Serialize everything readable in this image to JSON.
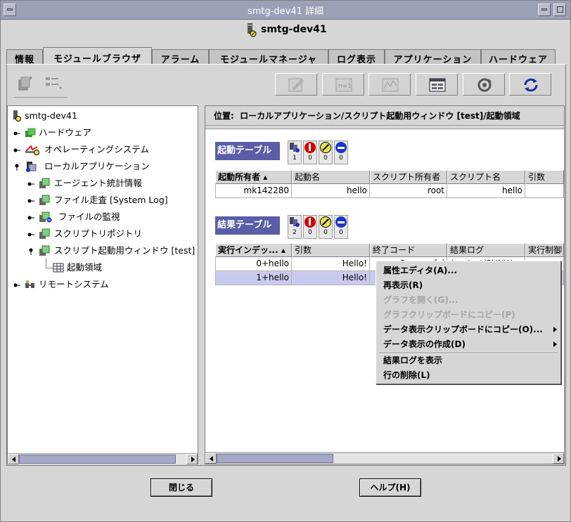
{
  "window": {
    "title": "smtg-dev41 詳細",
    "host": "smtg-dev41"
  },
  "tabs": [
    "情報",
    "モジュールブラウザ",
    "アラーム",
    "モジュールマネージャ",
    "ログ表示",
    "アプリケーション",
    "ハードウェア"
  ],
  "active_tab": "モジュールブラウザ",
  "tree": {
    "root": "smtg-dev41",
    "items": [
      "ハードウェア",
      "オペレーティングシステム",
      "ローカルアプリケーション",
      "エージェント統計情報",
      "ファイル走査 [System Log]",
      "ファイルの監視",
      "スクリプトリポジトリ",
      "スクリプト起動用ウィンドウ [test]",
      "起動領域",
      "リモートシステム"
    ]
  },
  "location": {
    "label": "位置:",
    "path": "ローカルアプリケーション/スクリプト起動用ウィンドウ [test]/起動領域"
  },
  "launch_table": {
    "title": "起動テーブル",
    "badges": [
      "1",
      "0",
      "0",
      "0"
    ],
    "headers": [
      "起動所有者",
      "起動名",
      "スクリプト所有者",
      "スクリプト名",
      "引数"
    ],
    "row": [
      "mk142280",
      "hello",
      "root",
      "hello",
      ""
    ]
  },
  "result_table": {
    "title": "結果テーブル",
    "badges": [
      "2",
      "0",
      "0",
      "0"
    ],
    "headers": [
      "実行インデッ...",
      "引数",
      "終了コード",
      "結果ログ",
      "実行制御"
    ],
    "rows": [
      [
        "0+hello",
        "Hello!",
        "Successful",
        "/var/opt/SUNW",
        ""
      ],
      [
        "1+hello",
        "Hello!",
        "",
        "",
        ""
      ]
    ]
  },
  "context_menu": {
    "items": [
      "属性エディタ(A)...",
      "再表示(R)",
      "グラフを開く(G)...",
      "グラフクリップボードにコピー(P)",
      "データ表示クリップボードにコピー(O)...",
      "データ表示の作成(D)",
      "結果ログを表示",
      "行の削除(L)"
    ]
  },
  "buttons": {
    "close": "閉じる",
    "help": "ヘルプ(H)"
  },
  "colors": {
    "titlebar": "#9aa1b5",
    "section": "#5a5ea6",
    "selected_row": "#c9cbee",
    "error": "#d10000",
    "warning": "#e8e34a",
    "down": "#1a36c9"
  }
}
